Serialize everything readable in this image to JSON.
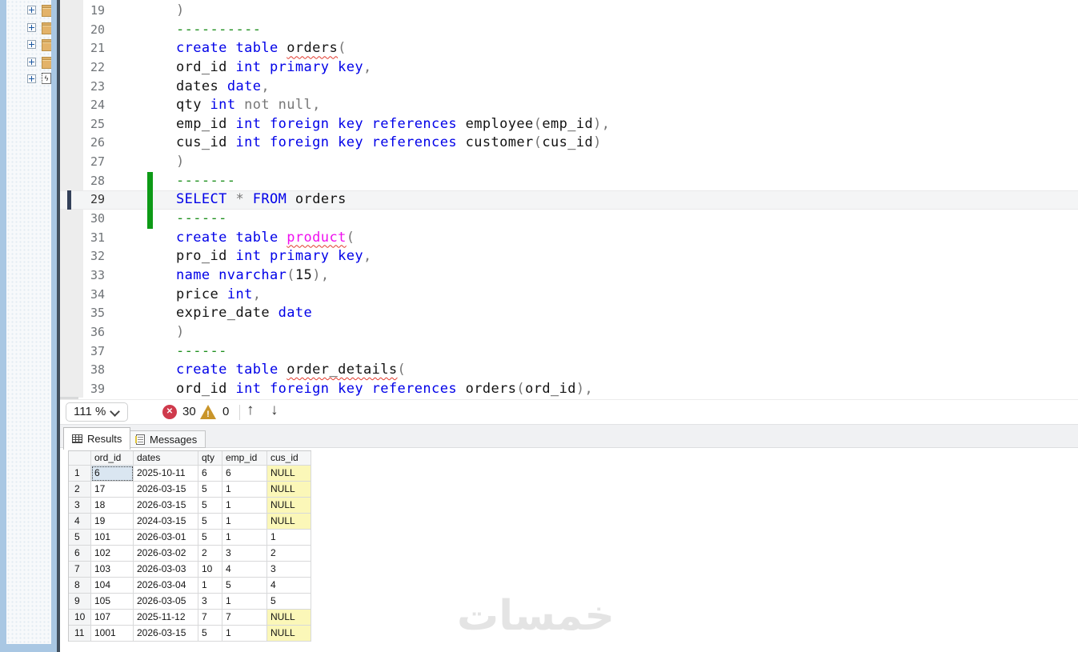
{
  "sidebar": {
    "items": [
      {
        "icon": "folder-icon"
      },
      {
        "icon": "folder-icon"
      },
      {
        "icon": "folder-icon"
      },
      {
        "icon": "folder-icon"
      },
      {
        "icon": "script-file-icon"
      }
    ]
  },
  "editor": {
    "lines": [
      {
        "n": 19,
        "seg": [
          [
            "gy",
            ")"
          ]
        ]
      },
      {
        "n": 20,
        "seg": [
          [
            "cm",
            "----------"
          ]
        ]
      },
      {
        "n": 21,
        "seg": [
          [
            "kw",
            "create table "
          ],
          [
            "er",
            "orders"
          ],
          [
            "gy",
            "("
          ]
        ]
      },
      {
        "n": 22,
        "seg": [
          [
            "id",
            "ord_id "
          ],
          [
            "kw",
            "int primary key"
          ],
          [
            "gy",
            ","
          ]
        ]
      },
      {
        "n": 23,
        "seg": [
          [
            "id",
            "dates "
          ],
          [
            "kw",
            "date"
          ],
          [
            "gy",
            ","
          ]
        ]
      },
      {
        "n": 24,
        "seg": [
          [
            "id",
            "qty "
          ],
          [
            "kw",
            "int "
          ],
          [
            "gy",
            "not null,"
          ]
        ]
      },
      {
        "n": 25,
        "seg": [
          [
            "id",
            "emp_id "
          ],
          [
            "kw",
            "int foreign key references "
          ],
          [
            "id",
            "employee"
          ],
          [
            "gy",
            "("
          ],
          [
            "id",
            "emp_id"
          ],
          [
            "gy",
            "),"
          ]
        ]
      },
      {
        "n": 26,
        "seg": [
          [
            "id",
            "cus_id "
          ],
          [
            "kw",
            "int foreign key references "
          ],
          [
            "id",
            "customer"
          ],
          [
            "gy",
            "("
          ],
          [
            "id",
            "cus_id"
          ],
          [
            "gy",
            ")"
          ]
        ]
      },
      {
        "n": 27,
        "seg": [
          [
            "gy",
            ")"
          ]
        ]
      },
      {
        "n": 28,
        "seg": [
          [
            "cm",
            "-------"
          ]
        ],
        "bar": true
      },
      {
        "n": 29,
        "seg": [
          [
            "kw",
            "SELECT "
          ],
          [
            "gy",
            "* "
          ],
          [
            "kw",
            "FROM "
          ],
          [
            "id",
            "orders"
          ]
        ],
        "bar": true,
        "current": true
      },
      {
        "n": 30,
        "seg": [
          [
            "cm",
            "------"
          ]
        ],
        "bar": true
      },
      {
        "n": 31,
        "seg": [
          [
            "kw",
            "create table "
          ],
          [
            "mg",
            "product"
          ],
          [
            "gy",
            "("
          ]
        ]
      },
      {
        "n": 32,
        "seg": [
          [
            "id",
            "pro_id "
          ],
          [
            "kw",
            "int primary key"
          ],
          [
            "gy",
            ","
          ]
        ]
      },
      {
        "n": 33,
        "seg": [
          [
            "kw",
            "name nvarchar"
          ],
          [
            "gy",
            "("
          ],
          [
            "id",
            "15"
          ],
          [
            "gy",
            "),"
          ]
        ]
      },
      {
        "n": 34,
        "seg": [
          [
            "id",
            "price "
          ],
          [
            "kw",
            "int"
          ],
          [
            "gy",
            ","
          ]
        ]
      },
      {
        "n": 35,
        "seg": [
          [
            "id",
            "expire_date "
          ],
          [
            "kw",
            "date"
          ]
        ]
      },
      {
        "n": 36,
        "seg": [
          [
            "gy",
            ")"
          ]
        ]
      },
      {
        "n": 37,
        "seg": [
          [
            "cm",
            "------"
          ]
        ]
      },
      {
        "n": 38,
        "seg": [
          [
            "kw",
            "create table "
          ],
          [
            "er",
            "order_details"
          ],
          [
            "gy",
            "("
          ]
        ]
      },
      {
        "n": 39,
        "seg": [
          [
            "id",
            "ord_id "
          ],
          [
            "kw",
            "int foreign key references "
          ],
          [
            "id",
            "orders"
          ],
          [
            "gy",
            "("
          ],
          [
            "id",
            "ord_id"
          ],
          [
            "gy",
            "),"
          ]
        ]
      }
    ]
  },
  "toolbar": {
    "zoom_level": "111 %",
    "error_count": "30",
    "warning_count": "0",
    "icons": {
      "error": "✕",
      "warning": "!",
      "up_arrow": "↑",
      "down_arrow": "↓"
    }
  },
  "tabs": [
    {
      "label": "Results",
      "icon": "results-grid-icon",
      "active": true
    },
    {
      "label": "Messages",
      "icon": "messages-note-icon",
      "active": false
    }
  ],
  "grid": {
    "columns": [
      "",
      "ord_id",
      "dates",
      "qty",
      "emp_id",
      "cus_id"
    ],
    "rows": [
      [
        "1",
        "6",
        "2025-10-11",
        "6",
        "6",
        "NULL"
      ],
      [
        "2",
        "17",
        "2026-03-15",
        "5",
        "1",
        "NULL"
      ],
      [
        "3",
        "18",
        "2026-03-15",
        "5",
        "1",
        "NULL"
      ],
      [
        "4",
        "19",
        "2024-03-15",
        "5",
        "1",
        "NULL"
      ],
      [
        "5",
        "101",
        "2026-03-01",
        "5",
        "1",
        "1"
      ],
      [
        "6",
        "102",
        "2026-03-02",
        "2",
        "3",
        "2"
      ],
      [
        "7",
        "103",
        "2026-03-03",
        "10",
        "4",
        "3"
      ],
      [
        "8",
        "104",
        "2026-03-04",
        "1",
        "5",
        "4"
      ],
      [
        "9",
        "105",
        "2026-03-05",
        "3",
        "1",
        "5"
      ],
      [
        "10",
        "107",
        "2025-11-12",
        "7",
        "7",
        "NULL"
      ],
      [
        "11",
        "1001",
        "2026-03-15",
        "5",
        "1",
        "NULL"
      ]
    ],
    "null_text": "NULL",
    "selected_cell": {
      "row": 0,
      "col": 1
    }
  },
  "watermark_text": "خمسات",
  "colors": {
    "keyword_blue": "#0000e8",
    "comment_green": "#1d8f1d",
    "error_squiggle_red": "#e23b2e",
    "magenta_identifier": "#ef10ef",
    "change_bar_green": "#0d9a16",
    "null_cell_yellow": "#fbf7b8",
    "selected_cell_blue": "#dae6f1",
    "sidebar_blue": "#a9c7e3",
    "error_badge_red": "#cf3a4c",
    "warning_amber": "#c9952a"
  }
}
